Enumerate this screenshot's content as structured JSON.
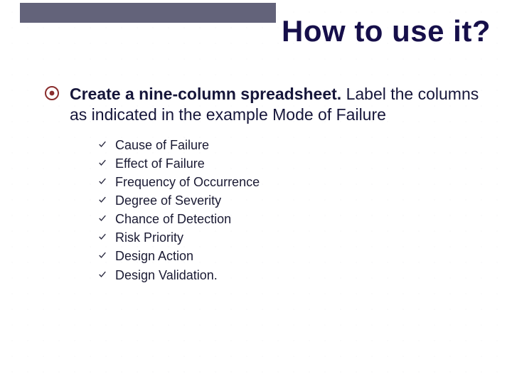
{
  "title": "How to use it?",
  "bullet": {
    "lead_bold": "Create a nine-column spreadsheet.",
    "rest": " Label the columns as indicated in the example Mode of Failure"
  },
  "sub_items": [
    "Cause of Failure",
    "Effect of Failure",
    "Frequency of Occurrence",
    "Degree of Severity",
    "Chance of Detection",
    "Risk Priority",
    "Design Action",
    "Design Validation."
  ]
}
